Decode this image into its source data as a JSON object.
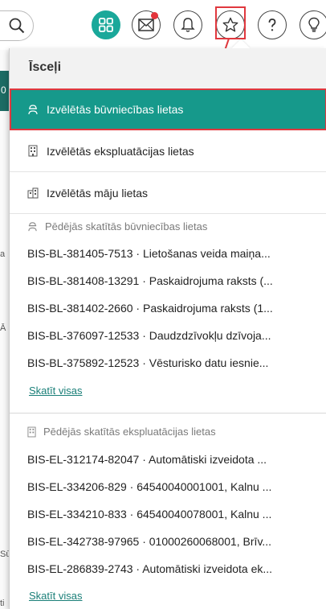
{
  "dropdown": {
    "title": "Īsceļi",
    "menu": [
      {
        "label": "Izvēlētās būvniecības lietas",
        "icon": "builder-icon"
      },
      {
        "label": "Izvēlētās ekspluatācijas lietas",
        "icon": "building-icon"
      },
      {
        "label": "Izvēlētās māju lietas",
        "icon": "houses-icon"
      }
    ],
    "recent_construction": {
      "title": "Pēdējās skatītās būvniecības lietas",
      "items": [
        "BIS-BL-381405-7513 · Lietošanas veida maiņa...",
        "BIS-BL-381408-13291 · Paskaidrojuma raksts (...",
        "BIS-BL-381402-2660 · Paskaidrojuma raksts (1...",
        "BIS-BL-376097-12533 · Daudzdzīvokļu dzīvoja...",
        "BIS-BL-375892-12523 · Vēsturisko datu iesnie..."
      ],
      "view_all": "Skatīt visas"
    },
    "recent_exploitation": {
      "title": "Pēdējās skatītās ekspluatācijas lietas",
      "items": [
        "BIS-EL-312174-82047 · Automātiski izveidota ...",
        "BIS-EL-334206-829 · 64540040001001, Kalnu ...",
        "BIS-EL-334210-833 · 64540040078001, Kalnu ...",
        "BIS-EL-342738-97965 · 01000260068001, Brīv...",
        "BIS-EL-286839-2743 · Automātiski izveidota ek..."
      ],
      "view_all": "Skatīt visas"
    }
  },
  "edge": {
    "teal_text": "0",
    "fragments": [
      "a",
      "Ā",
      "Sū",
      "ti"
    ]
  },
  "colors": {
    "accent": "#16998b",
    "highlight": "#e0383e",
    "link": "#1a7f78"
  }
}
